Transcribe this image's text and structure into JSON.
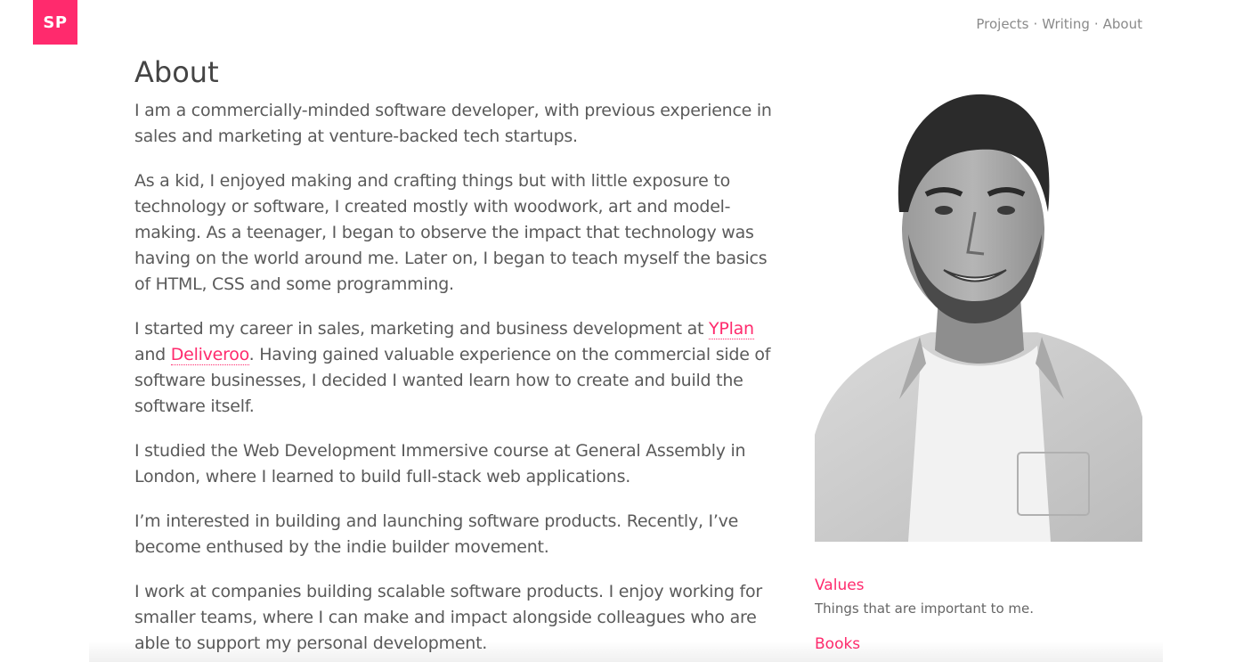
{
  "header": {
    "logo_text": "SP",
    "nav": [
      {
        "label": "Projects"
      },
      {
        "label": "Writing"
      },
      {
        "label": "About"
      }
    ],
    "separator": "·"
  },
  "main": {
    "title": "About",
    "paragraphs": {
      "p1": "I am a commercially-minded software developer, with previous experience in sales and marketing at venture-backed tech startups.",
      "p2": "As a kid, I enjoyed making and crafting things but with little exposure to technology or software, I created mostly with woodwork, art and model-making. As a teenager, I began to observe the impact that technology was having on the world around me. Later on, I began to teach myself the basics of HTML, CSS and some programming.",
      "p3_before": "I started my career in sales, marketing and business development at ",
      "p3_link1": "YPlan",
      "p3_mid": " and ",
      "p3_link2": "Deliveroo",
      "p3_after": ". Having gained valuable experience on the commercial side of software businesses, I decided I wanted learn how to create and build the software itself.",
      "p4": "I studied the Web Development Immersive course at General Assembly in London, where I learned to build full-stack web applications.",
      "p5": "I’m interested in building and launching software products. Recently, I’ve become enthused by the indie builder movement.",
      "p6": "I work at companies building scalable software products. I enjoy working for smaller teams, where I can make and impact alongside colleagues who are able to support my personal development."
    }
  },
  "sidebar": {
    "links": [
      {
        "label": "Values",
        "description": "Things that are important to me."
      },
      {
        "label": "Books"
      }
    ]
  },
  "colors": {
    "accent": "#ff2a6d",
    "text": "#5a5a5a",
    "heading": "#444444",
    "nav": "#8a8a8a"
  }
}
